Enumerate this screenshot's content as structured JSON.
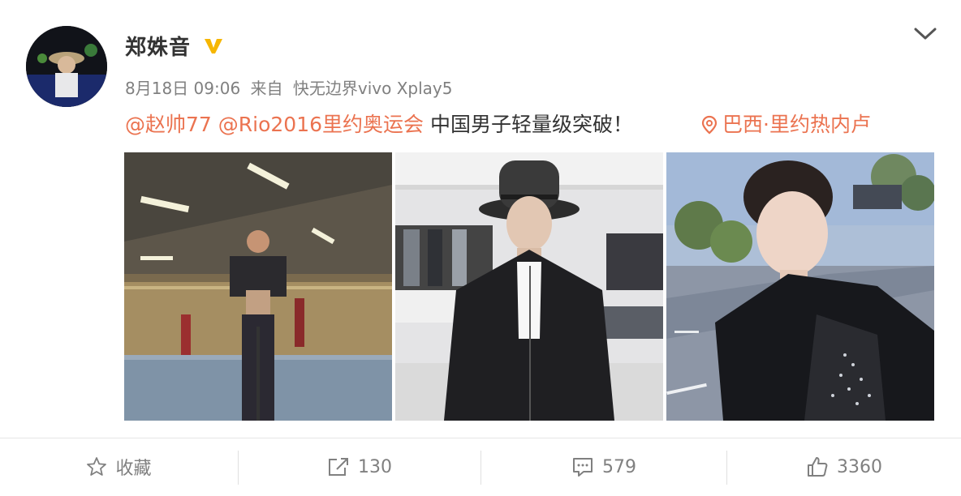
{
  "post": {
    "author": "郑姝音",
    "date": "8月18日 09:06",
    "source_prefix": "来自",
    "source": "快无边界vivo Xplay5",
    "mention1": "@赵帅77",
    "mention2": "@Rio2016里约奥运会",
    "text": "中国男子轻量级突破！",
    "location": "巴西·里约热内卢"
  },
  "actions": {
    "favorite_label": "收藏",
    "repost_count": "130",
    "comment_count": "579",
    "like_count": "3360"
  },
  "colors": {
    "accent": "#eb7350",
    "verified": "#f6b600",
    "muted": "#808080"
  },
  "icons": [
    "verified-icon",
    "chevron-down-icon",
    "location-pin-icon",
    "star-icon",
    "share-icon",
    "comment-icon",
    "like-icon"
  ]
}
